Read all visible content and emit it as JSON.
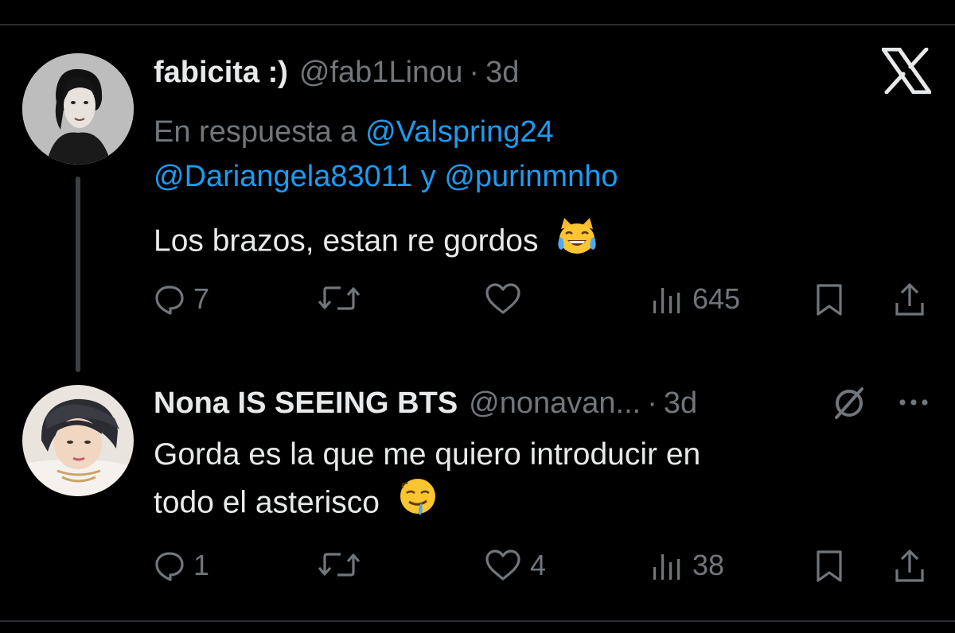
{
  "tweet1": {
    "display_name": "fabicita :)",
    "handle": "@fab1Linou",
    "separator": "·",
    "time": "3d",
    "reply_prefix": "En respuesta a",
    "mention1": "@Valspring24",
    "mention2": "@Dariangela83011",
    "reply_join": "y",
    "mention3": "@purinmnho",
    "text": "Los brazos, estan re gordos",
    "emoji": "cat-tears-of-joy-emoji",
    "replies": "7",
    "views": "645"
  },
  "tweet2": {
    "display_name": "Nona IS SEEING BTS",
    "handle": "@nonavan...",
    "separator": "·",
    "time": "3d",
    "text_line1": "Gorda es la que me quiero introducir en",
    "text_line2": "todo el asterisco",
    "emoji": "drooling-face-emoji",
    "replies": "1",
    "likes": "4",
    "views": "38"
  },
  "colors": {
    "background": "#000000",
    "primary_text": "#e7e9ea",
    "secondary_text": "#71767b",
    "link": "#1d9bf0"
  },
  "icons": [
    "x-logo-icon",
    "reply-icon",
    "retweet-icon",
    "like-icon",
    "views-icon",
    "bookmark-icon",
    "share-icon",
    "muted-icon",
    "more-icon"
  ]
}
